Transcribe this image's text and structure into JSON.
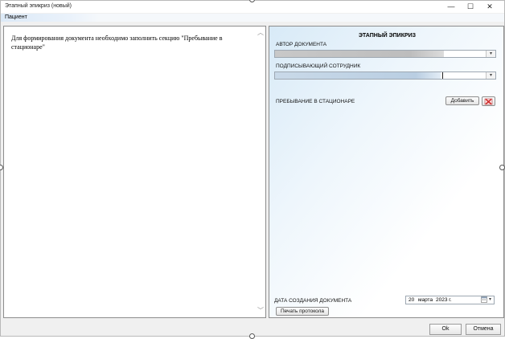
{
  "window": {
    "title": "Этапный эпикриз (новый)",
    "minimize_glyph": "—",
    "maximize_glyph": "☐",
    "close_glyph": "✕"
  },
  "menu": {
    "items": [
      {
        "label": "Пациент"
      }
    ]
  },
  "left_panel": {
    "message": "Для формирования документа необходимо заполнить секцию \"Пребывание в стационаре\""
  },
  "right_panel": {
    "title": "ЭТАПНЫЙ ЭПИКРИЗ",
    "author_label": "АВТОР ДОКУМЕНТА",
    "signer_label": "ПОДПИСЫВАЮЩИЙ СОТРУДНИК",
    "stay_label": "ПРЕБЫВАНИЕ В СТАЦИОНАРЕ",
    "add_button": "Добавить",
    "date_label": "ДАТА СОЗДАНИЯ ДОКУМЕНТА",
    "date": {
      "day": "20",
      "month": "марта",
      "year": "2023 г."
    },
    "print_button": "Печать протокола"
  },
  "footer": {
    "ok_button": "Ok",
    "cancel_button": "Отмена"
  },
  "icons": {
    "dropdown": "dropdown-arrow-icon",
    "delete": "delete-icon",
    "calendar": "calendar-icon"
  },
  "colors": {
    "delete_icon": "#d03030",
    "selection_blue": "#cfe0f3"
  }
}
